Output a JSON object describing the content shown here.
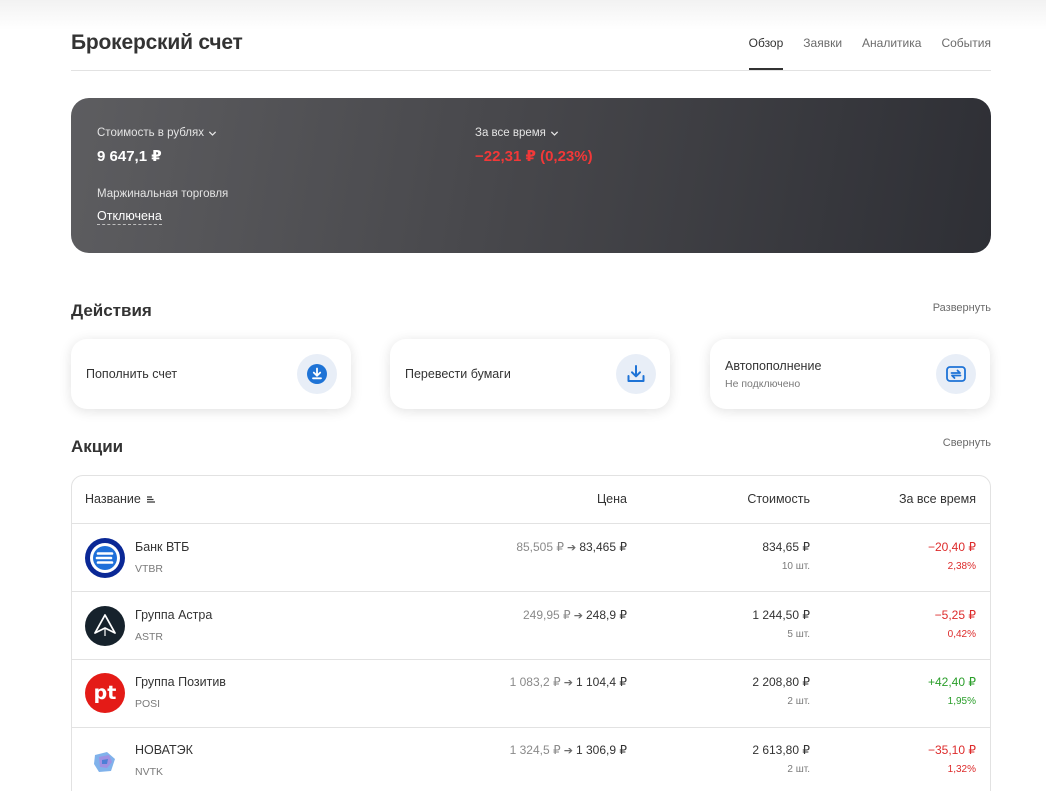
{
  "header": {
    "title": "Брокерский счет",
    "tabs": [
      {
        "label": "Обзор",
        "active": true
      },
      {
        "label": "Заявки",
        "active": false
      },
      {
        "label": "Аналитика",
        "active": false
      },
      {
        "label": "События",
        "active": false
      }
    ]
  },
  "summary": {
    "value_label": "Стоимость в рублях",
    "value": "9 647,1 ₽",
    "period_label": "За все время",
    "period_change": "−22,31 ₽ (0,23%)",
    "margin_label": "Маржинальная торговля",
    "margin_state": "Отключена"
  },
  "actions": {
    "title": "Действия",
    "toggle_label": "Развернуть",
    "items": [
      {
        "label": "Пополнить счет",
        "sub": "",
        "icon": "download-circle-icon"
      },
      {
        "label": "Перевести бумаги",
        "sub": "",
        "icon": "tray-download-icon"
      },
      {
        "label": "Автопополнение",
        "sub": "Не подключено",
        "icon": "auto-repeat-icon"
      }
    ]
  },
  "stocks": {
    "title": "Акции",
    "toggle_label": "Свернуть",
    "columns": {
      "name": "Название",
      "price": "Цена",
      "value": "Стоимость",
      "change": "За все время"
    },
    "rows": [
      {
        "name": "Банк ВТБ",
        "ticker": "VTBR",
        "price_old": "85,505 ₽",
        "price_new": "83,465 ₽",
        "value": "834,65 ₽",
        "qty": "10 шт.",
        "change_abs": "−20,40 ₽",
        "change_pct": "2,38%",
        "trend": "neg",
        "logo": "vtb-logo"
      },
      {
        "name": "Группа Астра",
        "ticker": "ASTR",
        "price_old": "249,95 ₽",
        "price_new": "248,9 ₽",
        "value": "1 244,50 ₽",
        "qty": "5 шт.",
        "change_abs": "−5,25 ₽",
        "change_pct": "0,42%",
        "trend": "neg",
        "logo": "astra-logo"
      },
      {
        "name": "Группа Позитив",
        "ticker": "POSI",
        "price_old": "1 083,2 ₽",
        "price_new": "1 104,4 ₽",
        "value": "2 208,80 ₽",
        "qty": "2 шт.",
        "change_abs": "+42,40 ₽",
        "change_pct": "1,95%",
        "trend": "pos",
        "logo": "positive-logo",
        "logo_text": "pt"
      },
      {
        "name": "НОВАТЭК",
        "ticker": "NVTK",
        "price_old": "1 324,5 ₽",
        "price_new": "1 306,9 ₽",
        "value": "2 613,80 ₽",
        "qty": "2 шт.",
        "change_abs": "−35,10 ₽",
        "change_pct": "1,32%",
        "trend": "neg",
        "logo": "novatek-logo"
      }
    ]
  },
  "colors": {
    "negative": "#dd2b2b",
    "positive": "#2a9e2a",
    "accent_blue": "#1e73d6",
    "summary_red": "#f23838"
  }
}
